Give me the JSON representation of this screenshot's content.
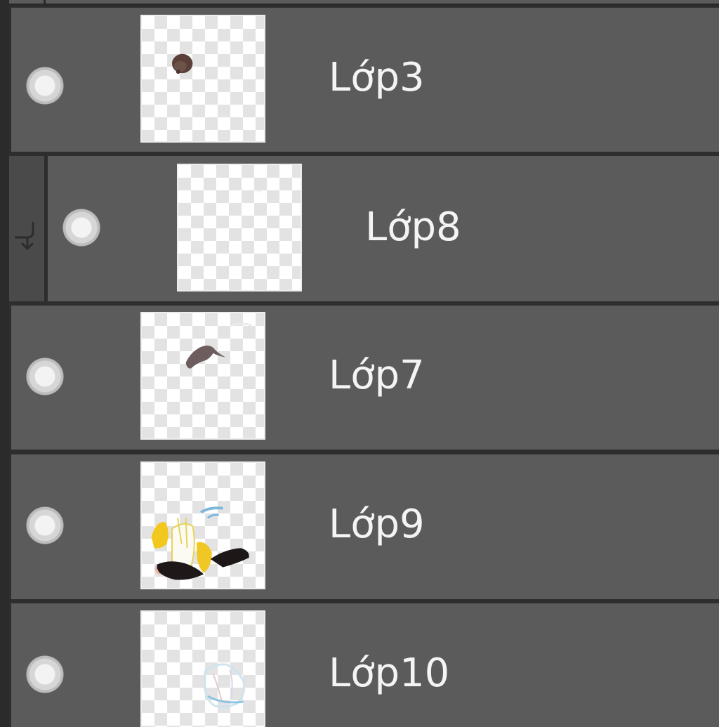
{
  "layers": [
    {
      "name": "Lớp3",
      "clipped": false,
      "visible": true,
      "thumbnail": "small-brown-blob"
    },
    {
      "name": "Lớp8",
      "clipped": true,
      "visible": true,
      "thumbnail": "near-empty"
    },
    {
      "name": "Lớp7",
      "clipped": false,
      "visible": true,
      "thumbnail": "brown-hair-strand"
    },
    {
      "name": "Lớp9",
      "clipped": false,
      "visible": true,
      "thumbnail": "yellow-black-figure"
    },
    {
      "name": "Lớp10",
      "clipped": false,
      "visible": true,
      "thumbnail": "light-blue-sketch"
    }
  ],
  "icons": {
    "visibility": "eye-toggle-icon",
    "clipping": "clipping-arrow-icon"
  },
  "colors": {
    "row_background": "#5b5b5b",
    "separator": "#2e2e2e",
    "text": "#f4f4f4"
  }
}
